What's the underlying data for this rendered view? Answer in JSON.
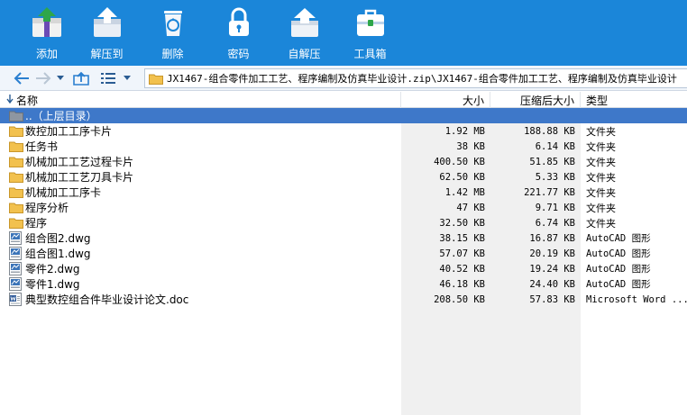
{
  "toolbar": {
    "add": "添加",
    "extract_to": "解压到",
    "delete": "删除",
    "password": "密码",
    "self_extract": "自解压",
    "toolbox": "工具箱"
  },
  "address": {
    "path": "JX1467-组合零件加工工艺、程序编制及仿真毕业设计.zip\\JX1467-组合零件加工工艺、程序编制及仿真毕业设计"
  },
  "columns": {
    "name": "名称",
    "size": "大小",
    "packed": "压缩后大小",
    "type": "类型"
  },
  "rows": [
    {
      "name": "..（上层目录）",
      "size": "",
      "packed": "",
      "type": "",
      "icon": "parent-folder-icon"
    },
    {
      "name": "数控加工工序卡片",
      "size": "1.92 MB",
      "packed": "188.88 KB",
      "type": "文件夹",
      "icon": "folder-icon"
    },
    {
      "name": "任务书",
      "size": "38 KB",
      "packed": "6.14 KB",
      "type": "文件夹",
      "icon": "folder-icon"
    },
    {
      "name": "机械加工工艺过程卡片",
      "size": "400.50 KB",
      "packed": "51.85 KB",
      "type": "文件夹",
      "icon": "folder-icon"
    },
    {
      "name": "机械加工工艺刀具卡片",
      "size": "62.50 KB",
      "packed": "5.33 KB",
      "type": "文件夹",
      "icon": "folder-icon"
    },
    {
      "name": "机械加工工序卡",
      "size": "1.42 MB",
      "packed": "221.77 KB",
      "type": "文件夹",
      "icon": "folder-icon"
    },
    {
      "name": "程序分析",
      "size": "47 KB",
      "packed": "9.71 KB",
      "type": "文件夹",
      "icon": "folder-icon"
    },
    {
      "name": "程序",
      "size": "32.50 KB",
      "packed": "6.74 KB",
      "type": "文件夹",
      "icon": "folder-icon"
    },
    {
      "name": "组合图2.dwg",
      "size": "38.15 KB",
      "packed": "16.87 KB",
      "type": "AutoCAD 图形",
      "icon": "dwg-file-icon"
    },
    {
      "name": "组合图1.dwg",
      "size": "57.07 KB",
      "packed": "20.19 KB",
      "type": "AutoCAD 图形",
      "icon": "dwg-file-icon"
    },
    {
      "name": "零件2.dwg",
      "size": "40.52 KB",
      "packed": "19.24 KB",
      "type": "AutoCAD 图形",
      "icon": "dwg-file-icon"
    },
    {
      "name": "零件1.dwg",
      "size": "46.18 KB",
      "packed": "24.40 KB",
      "type": "AutoCAD 图形",
      "icon": "dwg-file-icon"
    },
    {
      "name": "典型数控组合件毕业设计论文.doc",
      "size": "208.50 KB",
      "packed": "57.83 KB",
      "type": "Microsoft Word ...",
      "icon": "word-file-icon"
    }
  ],
  "colors": {
    "toolbar_bg": "#1b86d9",
    "selection": "#3e78c9",
    "folder": "#f2c14e"
  }
}
